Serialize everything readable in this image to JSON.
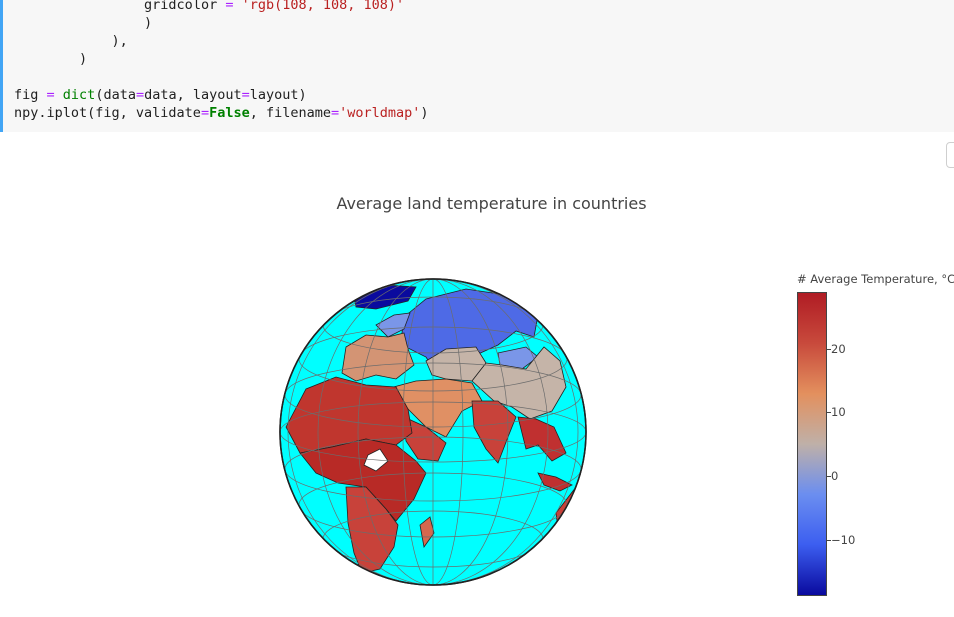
{
  "code": {
    "line1_indent": "                ",
    "line1_key": "gridcolor",
    "line1_eq": " = ",
    "line1_val": "'rgb(108, 108, 108)'",
    "line2": "                )",
    "line3": "            ),",
    "line4": "        )",
    "line6_a": "fig ",
    "line6_eq": "=",
    "line6_b": " ",
    "line6_fn": "dict",
    "line6_c": "(data",
    "line6_eq2": "=",
    "line6_d": "data, layout",
    "line6_eq3": "=",
    "line6_e": "layout)",
    "line7_a": "npy.iplot(fig, validate",
    "line7_eq": "=",
    "line7_kw": "False",
    "line7_b": ", filename",
    "line7_eq2": "=",
    "line7_str": "'worldmap'",
    "line7_c": ")"
  },
  "plot": {
    "title": "Average land temperature in countries",
    "colorbar_title": "# Average Temperature, °C",
    "colorbar_ticks": [
      "20",
      "10",
      "0",
      "−10"
    ],
    "ocean_color": "#00ffff",
    "grid_color": "rgb(108, 108, 108)",
    "colorscale": [
      "#0a0a9e",
      "#3c5ef0",
      "#6b8ef0",
      "#bfb0a8",
      "#e3905e",
      "#c84a3c",
      "#b01c24"
    ]
  }
}
